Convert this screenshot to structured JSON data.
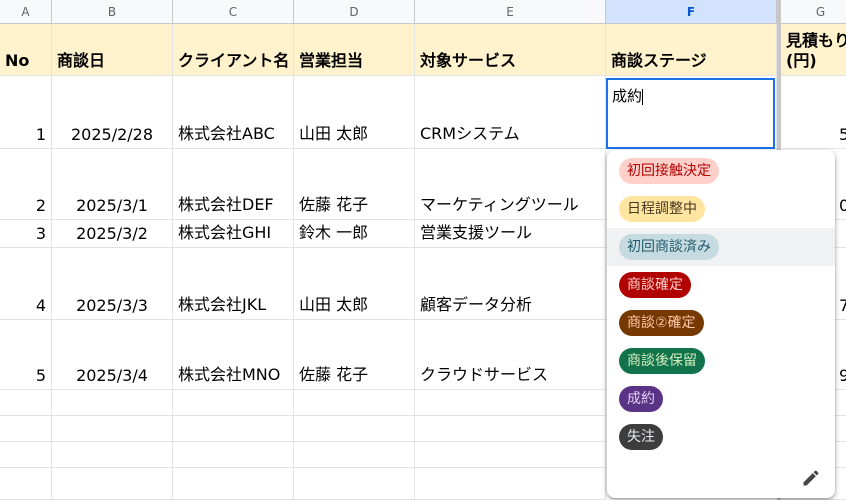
{
  "columns": [
    "A",
    "B",
    "C",
    "D",
    "E",
    "F",
    "G"
  ],
  "headers": {
    "no": "No",
    "date": "商談日",
    "client": "クライアント名",
    "owner": "営業担当",
    "service": "対象サービス",
    "stage": "商談ステージ",
    "estimate": "見積もり(円)"
  },
  "rows": [
    {
      "no": "1",
      "date": "2025/2/28",
      "client": "株式会社ABC",
      "owner": "山田 太郎",
      "service": "CRMシステム",
      "estimate": "5"
    },
    {
      "no": "2",
      "date": "2025/3/1",
      "client": "株式会社DEF",
      "owner": "佐藤 花子",
      "service": "マーケティングツール",
      "estimate": "0"
    },
    {
      "no": "3",
      "date": "2025/3/2",
      "client": "株式会社GHI",
      "owner": "鈴木 一郎",
      "service": "営業支援ツール",
      "estimate": ""
    },
    {
      "no": "4",
      "date": "2025/3/3",
      "client": "株式会社JKL",
      "owner": "山田 太郎",
      "service": "顧客データ分析",
      "estimate": "7"
    },
    {
      "no": "5",
      "date": "2025/3/4",
      "client": "株式会社MNO",
      "owner": "佐藤 花子",
      "service": "クラウドサービス",
      "estimate": "9"
    }
  ],
  "editor": {
    "value": "成約"
  },
  "dropdown": {
    "options": [
      {
        "label": "初回接触決定",
        "bg": "#ffcfc9",
        "fg": "#b10202"
      },
      {
        "label": "日程調整中",
        "bg": "#ffe5a0",
        "fg": "#473821"
      },
      {
        "label": "初回商談済み",
        "bg": "#c6dbe1",
        "fg": "#215a6c"
      },
      {
        "label": "商談確定",
        "bg": "#b10202",
        "fg": "#ffcfc9"
      },
      {
        "label": "商談②確定",
        "bg": "#753800",
        "fg": "#ffc8aa"
      },
      {
        "label": "商談後保留",
        "bg": "#11734b",
        "fg": "#d4edbc"
      },
      {
        "label": "成約",
        "bg": "#5a3286",
        "fg": "#e6cff2"
      },
      {
        "label": "失注",
        "bg": "#3d3d3d",
        "fg": "#e8eaed"
      }
    ],
    "highlighted_index": 2,
    "edit_icon": "pencil-icon"
  }
}
